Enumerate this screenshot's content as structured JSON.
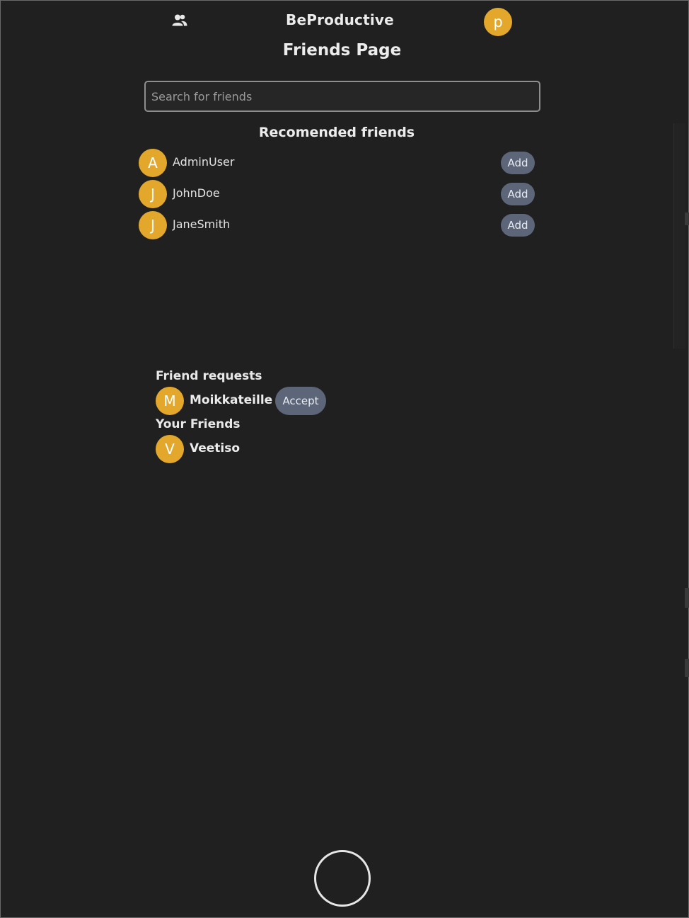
{
  "header": {
    "app_title": "BeProductive",
    "friends_icon": "users-icon",
    "profile_initial": "p"
  },
  "page_title": "Friends Page",
  "search": {
    "placeholder": "Search for friends",
    "value": ""
  },
  "recommended": {
    "heading": "Recomended friends",
    "add_label": "Add",
    "items": [
      {
        "initial": "A",
        "name": "AdminUser"
      },
      {
        "initial": "J",
        "name": "JohnDoe"
      },
      {
        "initial": "J",
        "name": "JaneSmith"
      }
    ]
  },
  "friend_requests": {
    "heading": "Friend requests",
    "accept_label": "Accept",
    "items": [
      {
        "initial": "M",
        "name": "Moikkateille"
      }
    ]
  },
  "your_friends": {
    "heading": "Your Friends",
    "items": [
      {
        "initial": "V",
        "name": "Veetiso"
      }
    ]
  },
  "colors": {
    "background": "#202020",
    "avatar": "#e3a82b",
    "button": "#5c6678",
    "text": "#ececec"
  }
}
